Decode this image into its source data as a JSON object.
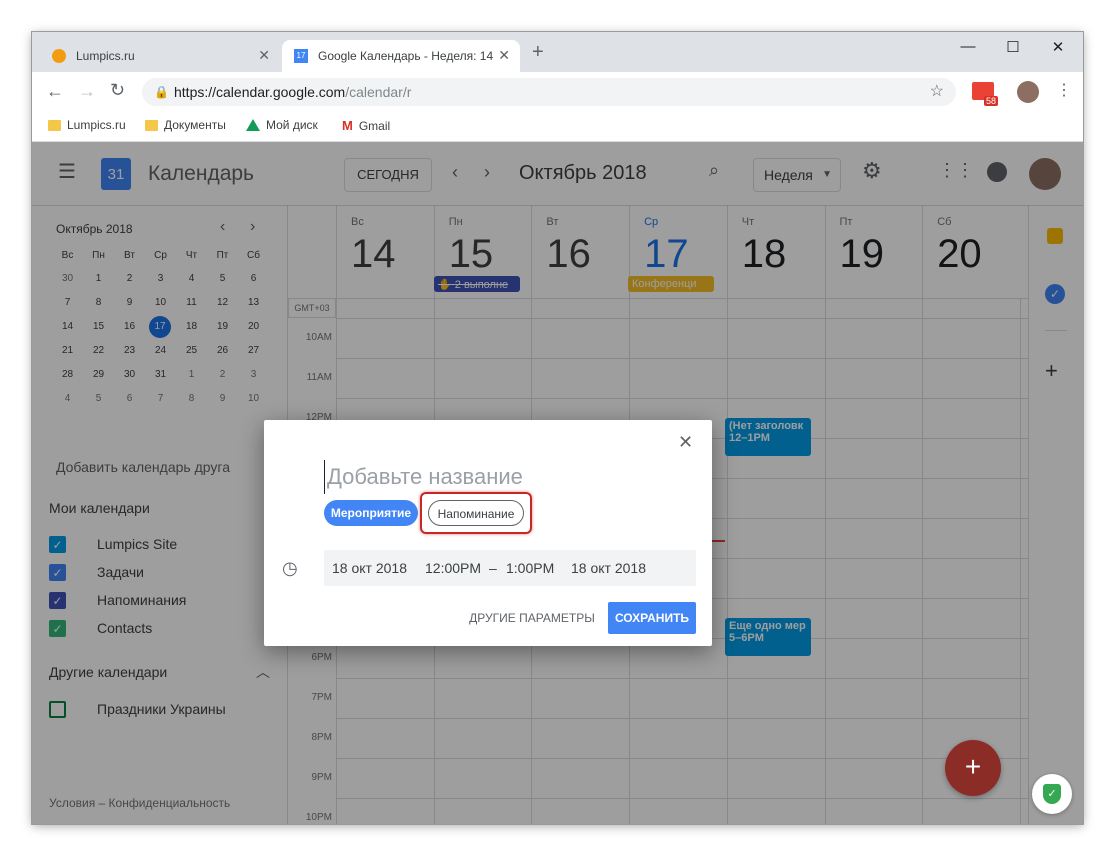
{
  "browser": {
    "tabs": [
      {
        "title": "Lumpics.ru"
      },
      {
        "title": "Google Календарь - Неделя: 14",
        "favicon_text": "17"
      }
    ],
    "url_host": "https://calendar.google.com",
    "url_path": "/calendar/r",
    "mail_badge": "58",
    "bookmarks": [
      "Lumpics.ru",
      "Документы",
      "Мой диск",
      "Gmail"
    ]
  },
  "header": {
    "logo_num": "31",
    "app_title": "Календарь",
    "today_button": "СЕГОДНЯ",
    "month_title": "Октябрь 2018",
    "view_select": "Неделя"
  },
  "mini_calendar": {
    "title": "Октябрь 2018",
    "weekdays": [
      "Вс",
      "Пн",
      "Вт",
      "Ср",
      "Чт",
      "Пт",
      "Сб"
    ],
    "weeks": [
      [
        "30",
        "1",
        "2",
        "3",
        "4",
        "5",
        "6"
      ],
      [
        "7",
        "8",
        "9",
        "10",
        "11",
        "12",
        "13"
      ],
      [
        "14",
        "15",
        "16",
        "17",
        "18",
        "19",
        "20"
      ],
      [
        "21",
        "22",
        "23",
        "24",
        "25",
        "26",
        "27"
      ],
      [
        "28",
        "29",
        "30",
        "31",
        "1",
        "2",
        "3"
      ],
      [
        "4",
        "5",
        "6",
        "7",
        "8",
        "9",
        "10"
      ]
    ],
    "today": "17"
  },
  "sidebar": {
    "add_friend_placeholder": "Добавить календарь друга",
    "my_calendars_title": "Мои календари",
    "my_calendars": [
      {
        "label": "Lumpics Site",
        "color": "#039be5"
      },
      {
        "label": "Задачи",
        "color": "#4285f4"
      },
      {
        "label": "Напоминания",
        "color": "#3f51b5"
      },
      {
        "label": "Contacts",
        "color": "#33b679"
      }
    ],
    "other_calendars_title": "Другие календари",
    "other_calendars": [
      {
        "label": "Праздники Украины",
        "color": "#0b8043"
      }
    ],
    "footer": "Условия – Конфиденциальность"
  },
  "week": {
    "timezone": "GMT+03",
    "days": [
      {
        "name": "Вс",
        "num": "14"
      },
      {
        "name": "Пн",
        "num": "15"
      },
      {
        "name": "Вт",
        "num": "16"
      },
      {
        "name": "Ср",
        "num": "17"
      },
      {
        "name": "Чт",
        "num": "18"
      },
      {
        "name": "Пт",
        "num": "19"
      },
      {
        "name": "Сб",
        "num": "20"
      }
    ],
    "hours": [
      "10AM",
      "11AM",
      "12PM",
      "6PM",
      "7PM",
      "8PM",
      "9PM",
      "10PM"
    ],
    "allday_events": [
      {
        "label": "2 выполне",
        "color": "#3f51b5"
      },
      {
        "label": "Конференци",
        "color": "#f6bf26"
      }
    ],
    "events": [
      {
        "title": "(Нет заголовк",
        "time": "12–1PM",
        "color": "#039be5"
      },
      {
        "title": "Еще одно мер",
        "time": "5–6PM",
        "color": "#039be5"
      }
    ]
  },
  "dialog": {
    "title_placeholder": "Добавьте название",
    "tab_event": "Мероприятие",
    "tab_reminder": "Напоминание",
    "start_date": "18 окт 2018",
    "start_time": "12:00PM",
    "dash": "–",
    "end_time": "1:00PM",
    "end_date": "18 окт 2018",
    "more_options": "ДРУГИЕ ПАРАМЕТРЫ",
    "save": "СОХРАНИТЬ"
  },
  "colors": {
    "accent": "#4285f4",
    "fab": "#db4437",
    "highlight_ring": "#c62828"
  }
}
